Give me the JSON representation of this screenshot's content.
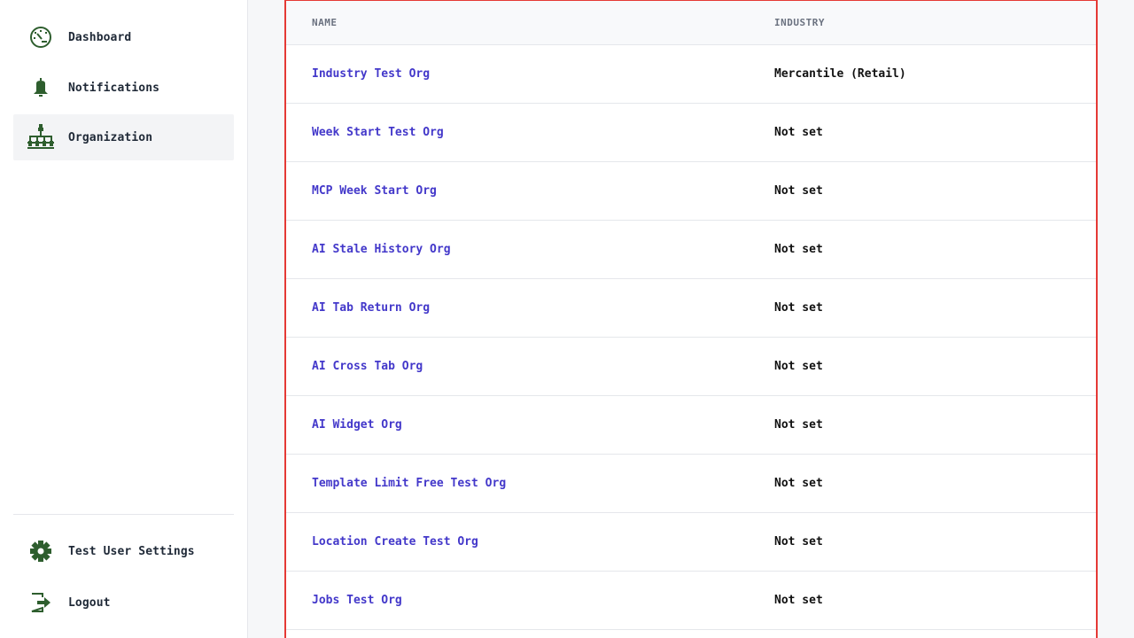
{
  "sidebar": {
    "top_items": [
      {
        "label": "Dashboard",
        "icon": "dashboard-gauge-icon",
        "active": false
      },
      {
        "label": "Notifications",
        "icon": "bell-icon",
        "active": false
      },
      {
        "label": "Organization",
        "icon": "org-chart-icon",
        "active": true
      }
    ],
    "bottom_items": [
      {
        "label": "Test User Settings",
        "icon": "gear-icon"
      },
      {
        "label": "Logout",
        "icon": "logout-icon"
      }
    ]
  },
  "table": {
    "columns": {
      "name": "NAME",
      "industry": "INDUSTRY"
    },
    "rows": [
      {
        "name": "Industry Test Org",
        "industry": "Mercantile (Retail)"
      },
      {
        "name": "Week Start Test Org",
        "industry": "Not set"
      },
      {
        "name": "MCP Week Start Org",
        "industry": "Not set"
      },
      {
        "name": "AI Stale History Org",
        "industry": "Not set"
      },
      {
        "name": "AI Tab Return Org",
        "industry": "Not set"
      },
      {
        "name": "AI Cross Tab Org",
        "industry": "Not set"
      },
      {
        "name": "AI Widget Org",
        "industry": "Not set"
      },
      {
        "name": "Template Limit Free Test Org",
        "industry": "Not set"
      },
      {
        "name": "Location Create Test Org",
        "industry": "Not set"
      },
      {
        "name": "Jobs Test Org",
        "industry": "Not set"
      }
    ]
  },
  "colors": {
    "icon_green": "#2e5e2e",
    "link": "#4338ca",
    "frame_border": "#e53935"
  }
}
